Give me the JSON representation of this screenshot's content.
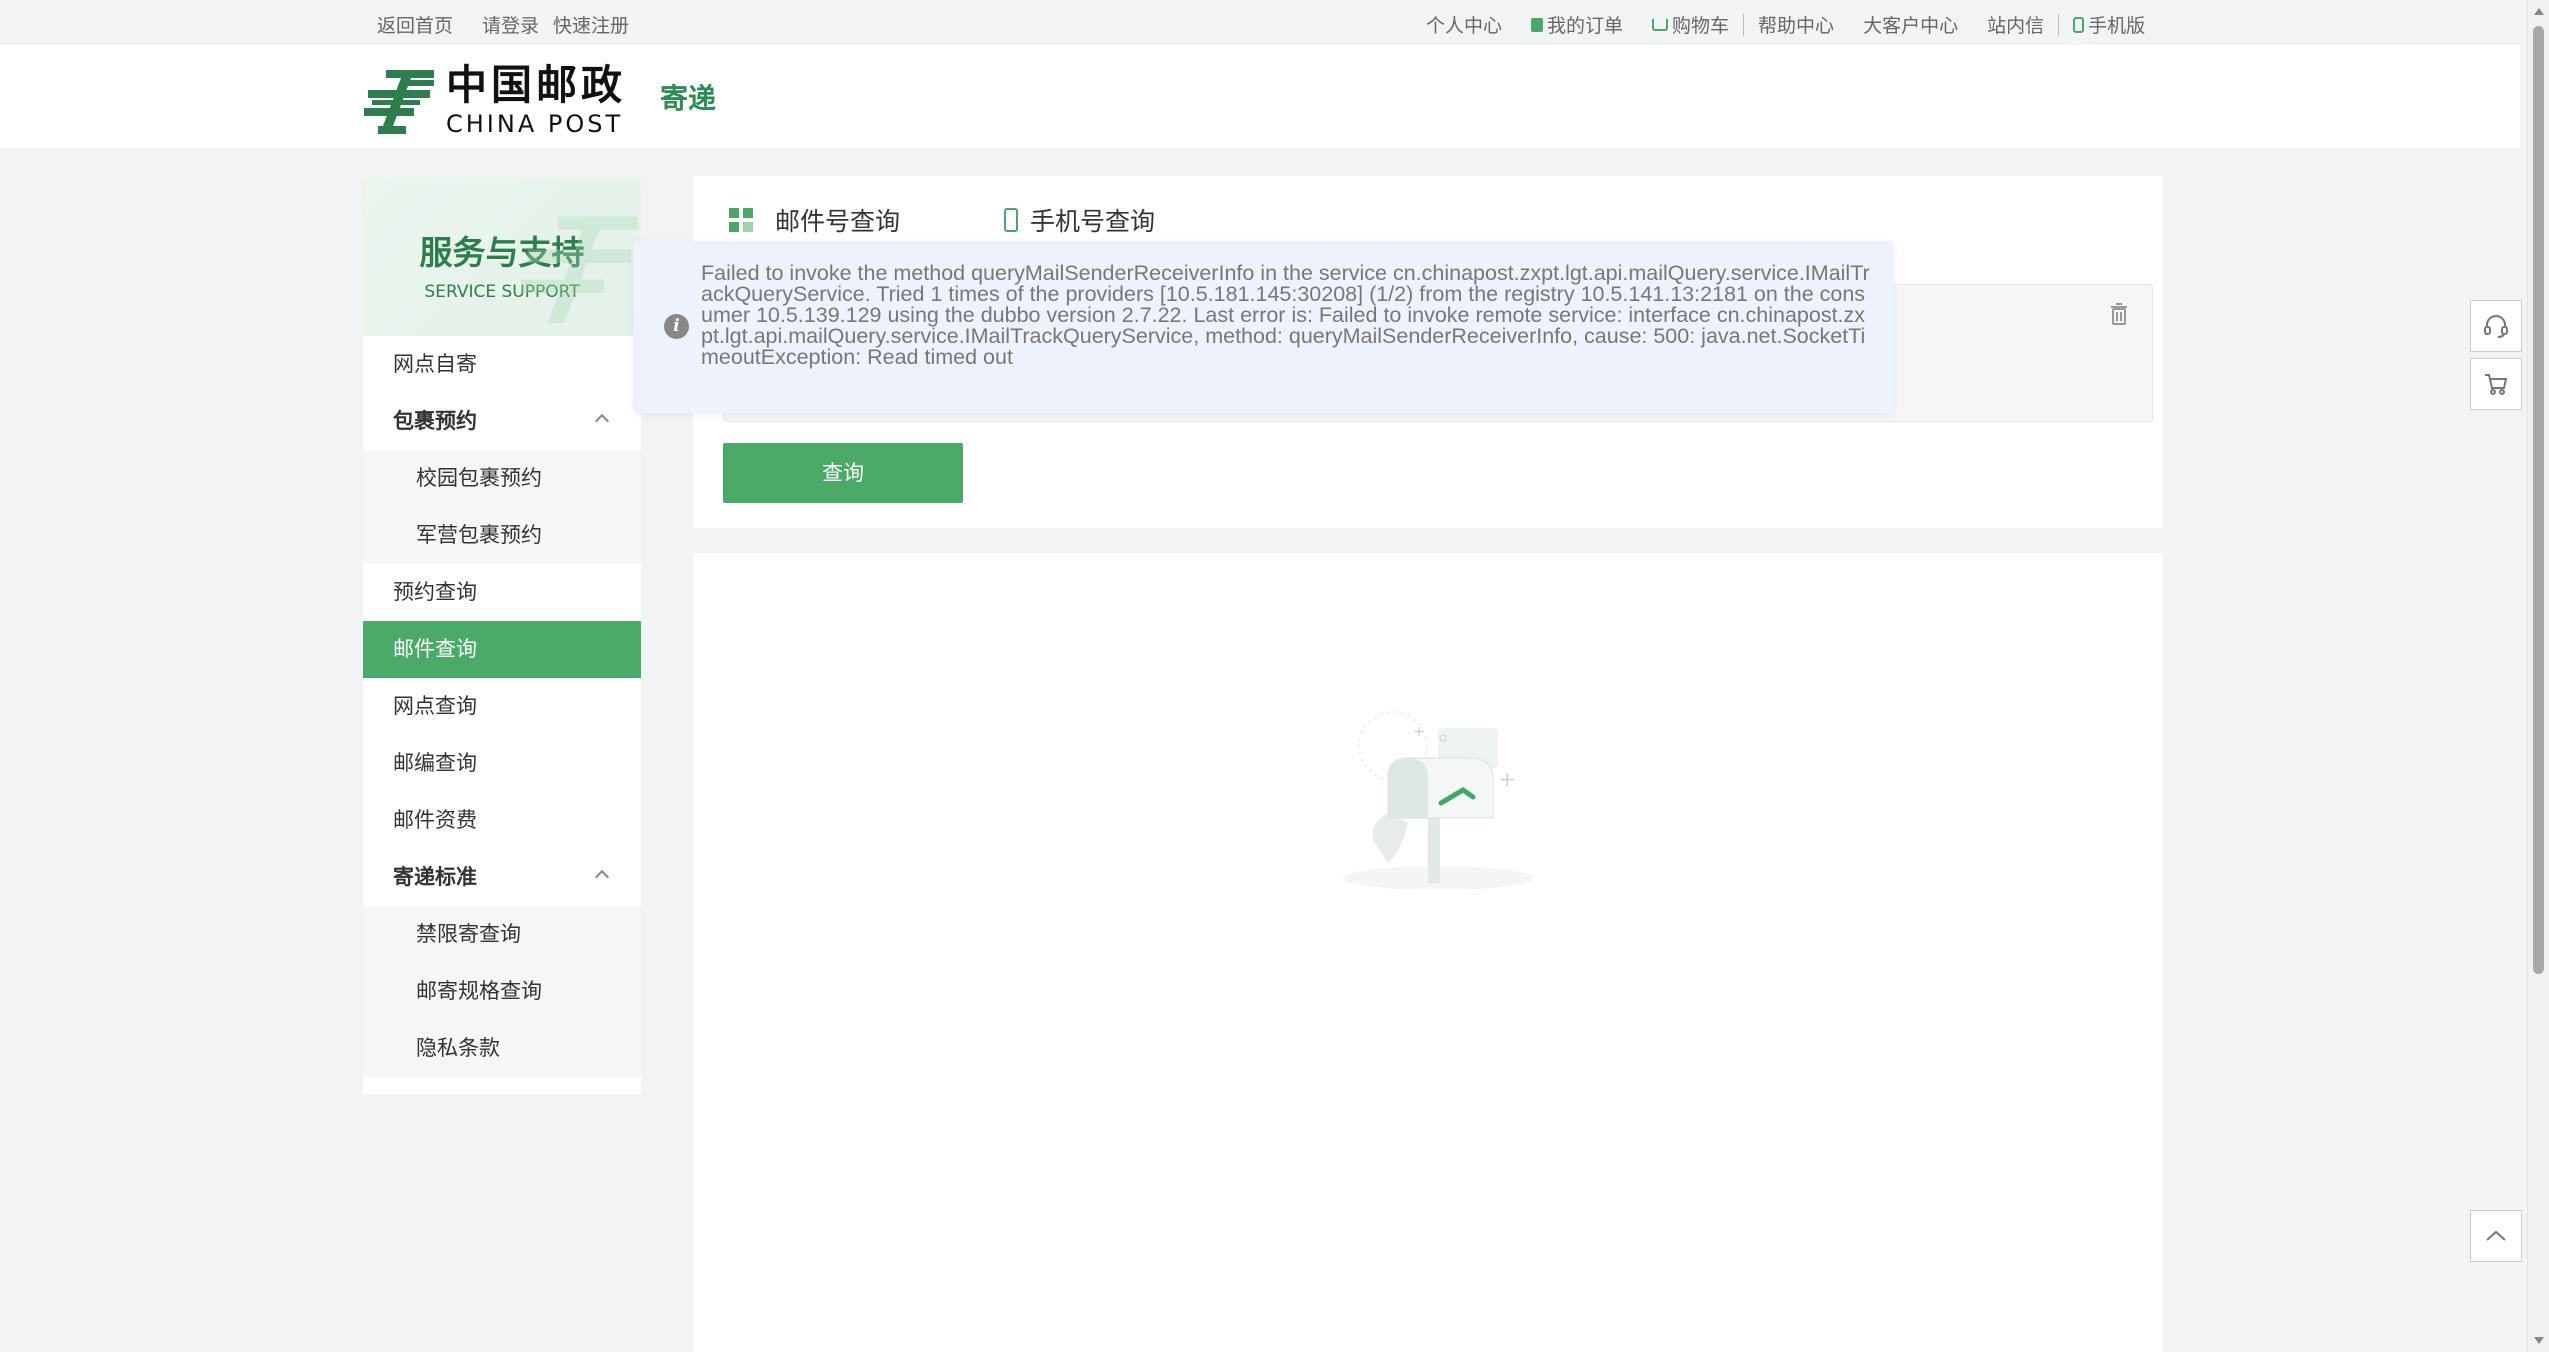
{
  "topbar": {
    "home": "返回首页",
    "login": "请登录",
    "register": "快速注册",
    "personal": "个人中心",
    "orders": "我的订单",
    "cart": "购物车",
    "help": "帮助中心",
    "bigclient": "大客户中心",
    "inbox": "站内信",
    "mobile": "手机版"
  },
  "header": {
    "logo_cn": "中国邮政",
    "logo_en": "CHINA POST",
    "service": "寄递"
  },
  "sidebar": {
    "title": "服务与支持",
    "subtitle": "SERVICE SUPPORT",
    "items": [
      {
        "label": "网点自寄"
      },
      {
        "label": "包裹预约"
      },
      {
        "label": "校园包裹预约"
      },
      {
        "label": "军营包裹预约"
      },
      {
        "label": "预约查询"
      },
      {
        "label": "邮件查询"
      },
      {
        "label": "网点查询"
      },
      {
        "label": "邮编查询"
      },
      {
        "label": "邮件资费"
      },
      {
        "label": "寄递标准"
      },
      {
        "label": "禁限寄查询"
      },
      {
        "label": "邮寄规格查询"
      },
      {
        "label": "隐私条款"
      }
    ]
  },
  "query": {
    "tab_mail": "邮件号查询",
    "tab_phone": "手机号查询",
    "button": "查询"
  },
  "error": {
    "message": "Failed to invoke the method queryMailSenderReceiverInfo in the service cn.chinapost.zxpt.lgt.api.mailQuery.service.IMailTrackQueryService. Tried 1 times of the providers [10.5.181.145:30208] (1/2) from the registry 10.5.141.13:2181 on the consumer 10.5.139.129 using the dubbo version 2.7.22. Last error is: Failed to invoke remote service: interface cn.chinapost.zxpt.lgt.api.mailQuery.service.IMailTrackQueryService, method: queryMailSenderReceiverInfo, cause: 500: java.net.SocketTimeoutException: Read timed out"
  },
  "colors": {
    "brand_green": "#4caa69",
    "dark_green": "#2e7d4f"
  }
}
